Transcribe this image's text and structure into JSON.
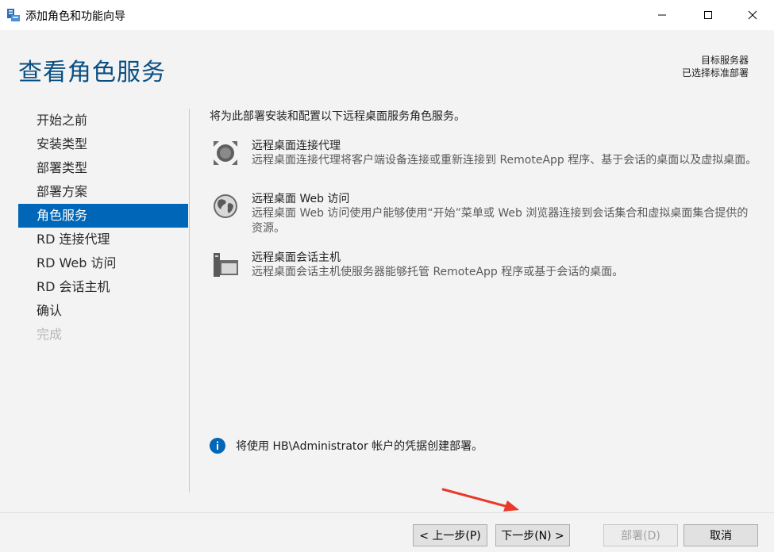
{
  "window": {
    "title": "添加角色和功能向导",
    "minimize": "minimize",
    "maximize": "maximize",
    "close": "close"
  },
  "header": {
    "page_title": "查看角色服务",
    "dest_label": "目标服务器",
    "dest_value": "已选择标准部署"
  },
  "nav": {
    "items": [
      {
        "label": "开始之前",
        "state": "normal"
      },
      {
        "label": "安装类型",
        "state": "normal"
      },
      {
        "label": "部署类型",
        "state": "normal"
      },
      {
        "label": "部署方案",
        "state": "normal"
      },
      {
        "label": "角色服务",
        "state": "active"
      },
      {
        "label": "RD 连接代理",
        "state": "normal"
      },
      {
        "label": "RD Web 访问",
        "state": "normal"
      },
      {
        "label": "RD 会话主机",
        "state": "normal"
      },
      {
        "label": "确认",
        "state": "normal"
      },
      {
        "label": "完成",
        "state": "disabled"
      }
    ]
  },
  "main": {
    "intro": "将为此部署安装和配置以下远程桌面服务角色服务。",
    "services": [
      {
        "name": "远程桌面连接代理",
        "desc": "远程桌面连接代理将客户端设备连接或重新连接到 RemoteApp 程序、基于会话的桌面以及虚拟桌面。",
        "icon": "connection-broker-icon"
      },
      {
        "name": "远程桌面 Web 访问",
        "desc": "远程桌面 Web 访问使用户能够使用“开始”菜单或 Web 浏览器连接到会话集合和虚拟桌面集合提供的资源。",
        "icon": "web-access-icon"
      },
      {
        "name": "远程桌面会话主机",
        "desc": "远程桌面会话主机使服务器能够托管 RemoteApp 程序或基于会话的桌面。",
        "icon": "session-host-icon"
      }
    ],
    "info": "将使用 HB\\Administrator 帐户的凭据创建部署。"
  },
  "footer": {
    "prev": "< 上一步(P)",
    "next": "下一步(N) >",
    "deploy": "部署(D)",
    "cancel": "取消"
  },
  "colors": {
    "accent": "#0067b8",
    "title": "#0a4f82",
    "annotation_arrow": "#e8392b"
  }
}
